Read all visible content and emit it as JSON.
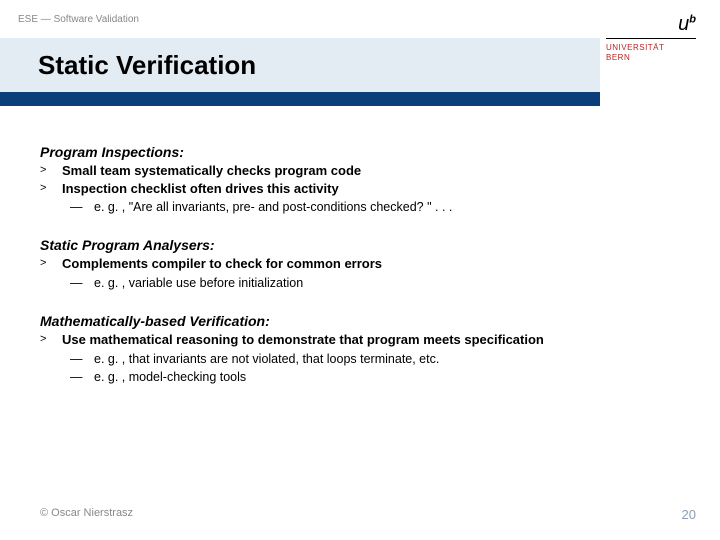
{
  "header": {
    "breadcrumb": "ESE — Software Validation",
    "title": "Static Verification",
    "logo": {
      "symbol_main": "u",
      "symbol_sup": "b",
      "line1": "UNIVERSITÄT",
      "line2": "BERN"
    }
  },
  "sections": [
    {
      "title": "Program Inspections:",
      "bullets": [
        "Small team systematically checks program code",
        "Inspection checklist often drives this activity"
      ],
      "subs": [
        "e. g. , \"Are all invariants, pre- and post-conditions checked? \" . . ."
      ]
    },
    {
      "title": "Static Program Analysers:",
      "bullets": [
        "Complements compiler to check for common errors"
      ],
      "subs": [
        "e. g. , variable use before initialization"
      ]
    },
    {
      "title": "Mathematically-based Verification:",
      "bullets": [
        "Use mathematical reasoning to demonstrate that program meets specification"
      ],
      "subs": [
        "e. g. , that invariants are not violated, that loops terminate, etc.",
        "e. g. , model-checking tools"
      ]
    }
  ],
  "footer": {
    "copyright": "© Oscar Nierstrasz",
    "page": "20"
  },
  "markers": {
    "bullet": ">",
    "sub": "—"
  }
}
